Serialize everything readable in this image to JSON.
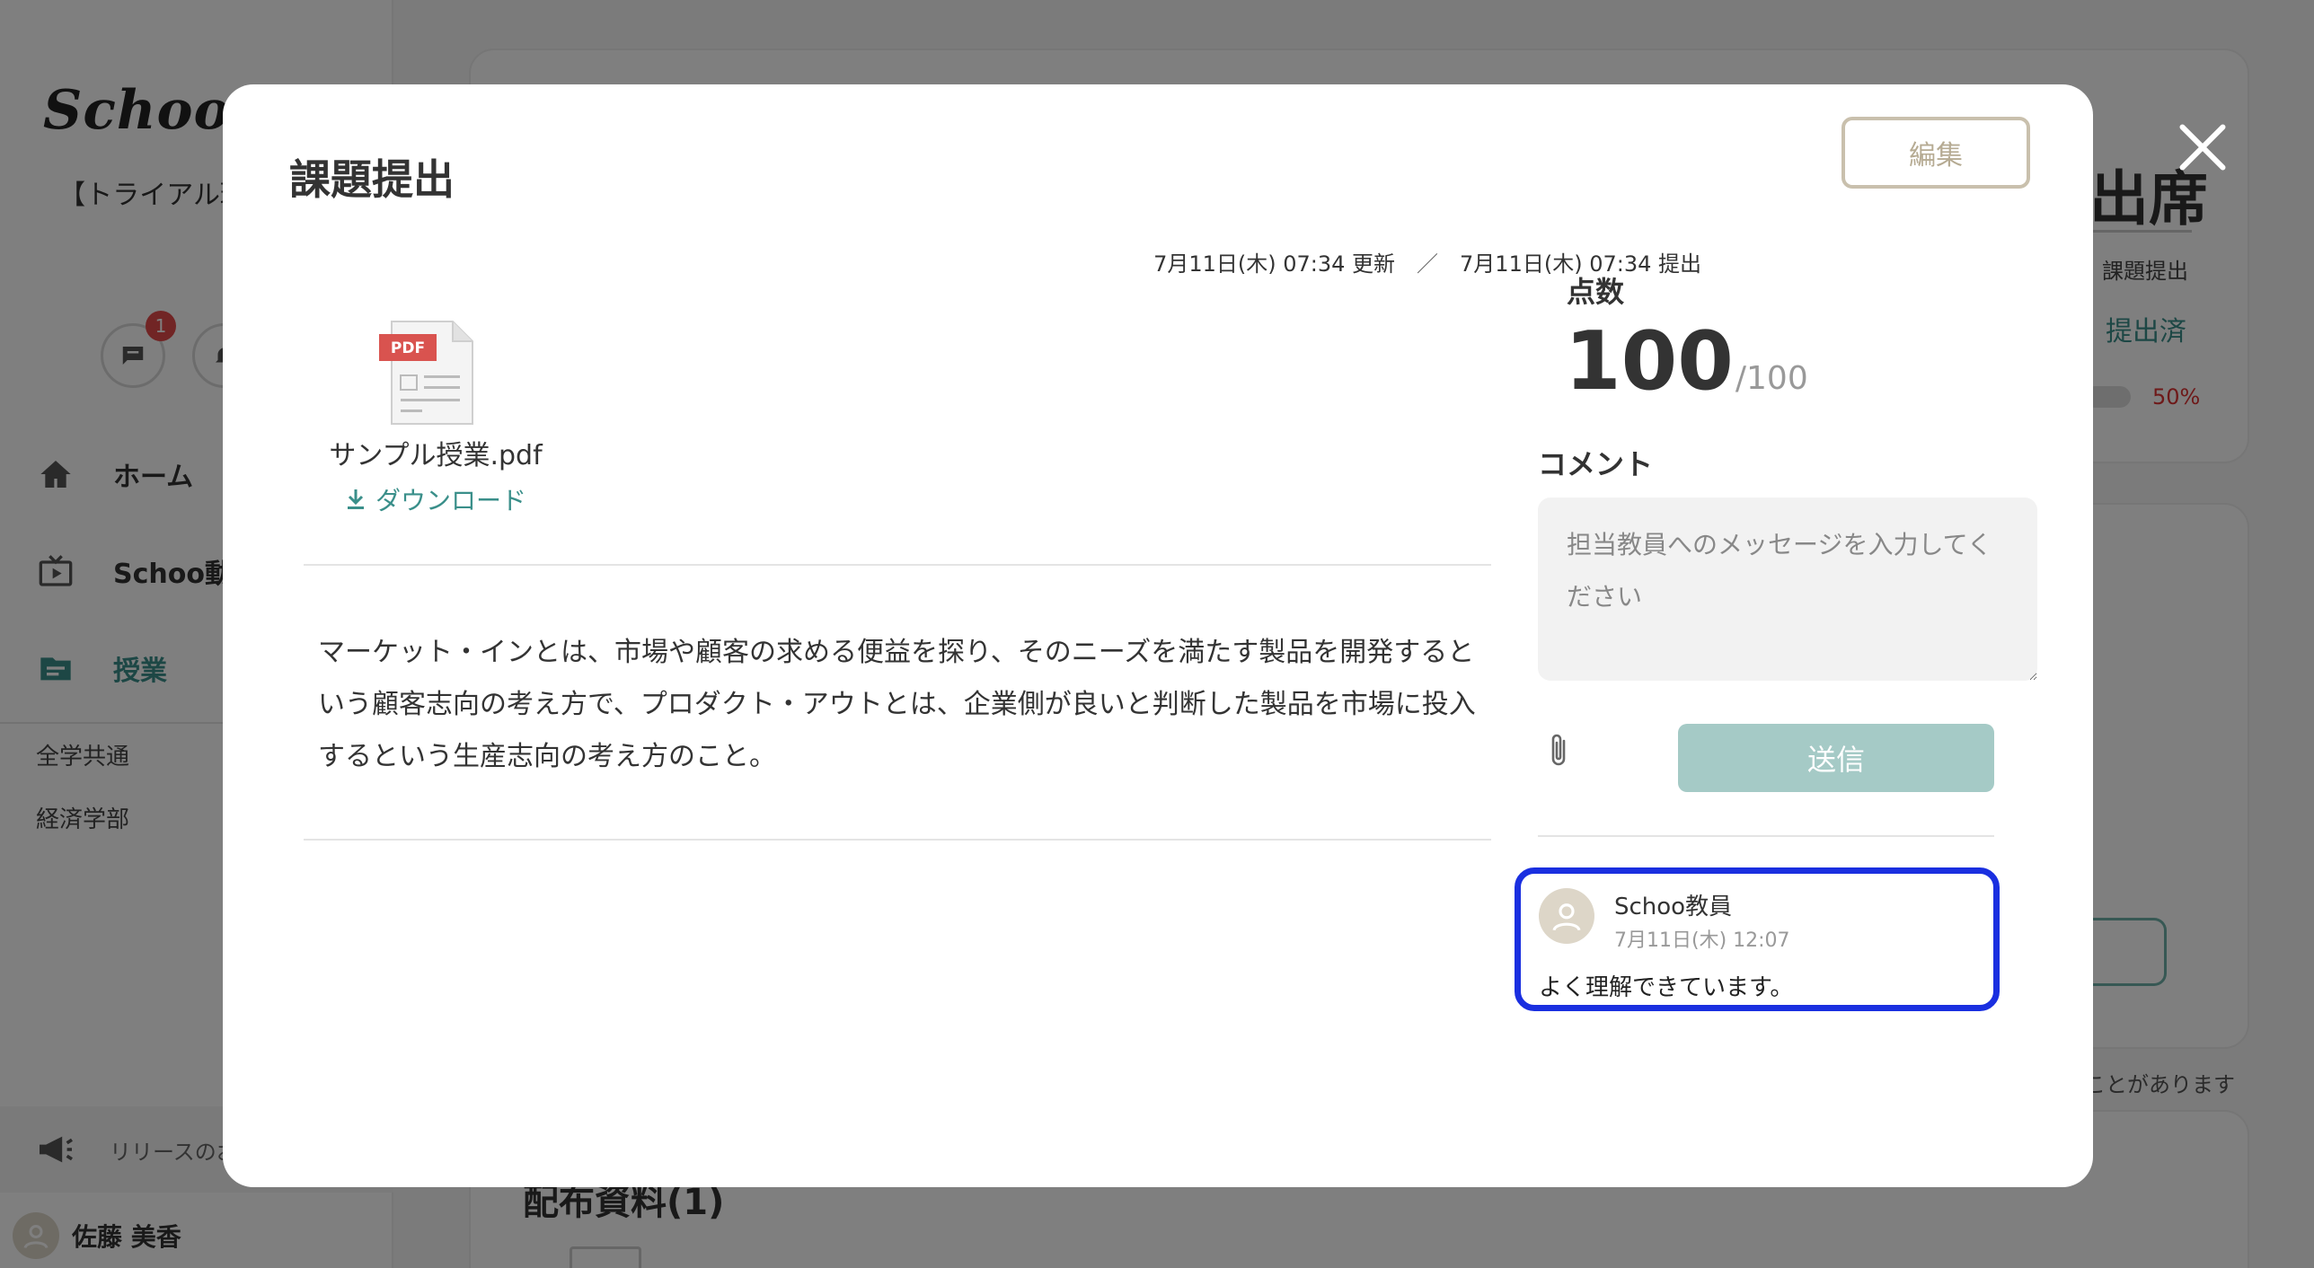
{
  "background": {
    "sidebar": {
      "logo_text": "SchooSw",
      "org_name": "【トライアル環 choo学園",
      "badge_count": "1",
      "nav": [
        {
          "label": "ホーム",
          "icon": "home-icon"
        },
        {
          "label": "Schoo動画",
          "icon": "tv-icon"
        },
        {
          "label": "授業",
          "icon": "folder-icon"
        }
      ],
      "sub_nav": [
        "全学共通",
        "経済学部"
      ],
      "release_text": "リリースのお",
      "user_name": "佐藤 美香"
    },
    "main": {
      "attendance": "出席",
      "submission_label": "課題提出",
      "submission_status": "提出済",
      "progress_percent": "50%",
      "note": "ことがあります",
      "materials_title": "配布資料(1)"
    }
  },
  "modal": {
    "title": "課題提出",
    "edit_label": "編集",
    "close_icon": "close-icon",
    "meta": {
      "updated": "7月11日(木) 07:34 更新",
      "separator": "／",
      "submitted": "7月11日(木) 07:34 提出"
    },
    "file": {
      "badge": "PDF",
      "name": "サンプル授業.pdf",
      "download_label": "ダウンロード"
    },
    "answer_text": "マーケット・インとは、市場や顧客の求める便益を探り、そのニーズを満たす製品を開発するという顧客志向の考え方で、プロダクト・アウトとは、企業側が良いと判断した製品を市場に投入するという生産志向の考え方のこと。",
    "score": {
      "label": "点数",
      "value": "100",
      "max": "/100"
    },
    "comment": {
      "label": "コメント",
      "placeholder": "担当教員へのメッセージを入力してください",
      "send_label": "送信"
    },
    "comments": [
      {
        "author": "Schoo教員",
        "date": "7月11日(木) 12:07",
        "body": "よく理解できています。"
      }
    ]
  },
  "colors": {
    "accent": "#3a8f8a",
    "send_disabled": "#a5cac6",
    "edit_border": "#c9c0ad",
    "highlight": "#1a2fe0"
  }
}
